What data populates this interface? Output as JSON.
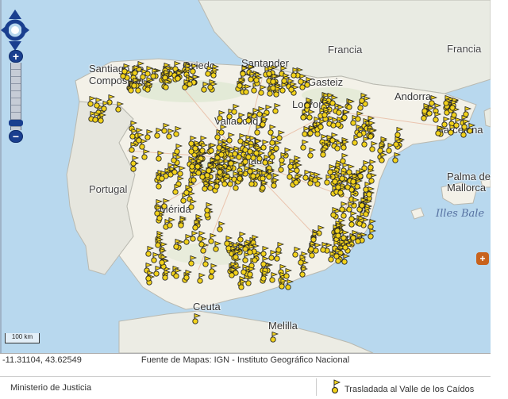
{
  "map": {
    "labels": {
      "francia1": "Francia",
      "francia2": "Francia",
      "portugal": "Portugal",
      "illes_balears": "Illes Bale",
      "palma": "Palma de\nMallorca",
      "santiago": "Santiago de\nCompostela",
      "oviedo": "Oviedo",
      "santander": "Santander",
      "gasteiz": "Gasteiz",
      "logrono": "Logroño",
      "andorra": "Andorra",
      "barcelona": "Barcelona",
      "valladolid": "Valladolid",
      "madrid": "Madrid",
      "merida": "Mérida",
      "murcia": "Murcia",
      "ceuta": "Ceuta",
      "melilla": "Melilla"
    },
    "scale_label": "100 km",
    "marker_color": "#f2d21b"
  },
  "status": {
    "coords": "-11.31104, 43.62549",
    "source": "Fuente de Mapas: IGN - Instituto Geográfico Nacional"
  },
  "footer": {
    "ministry": "Ministerio de Justicia",
    "legend_label": "Trasladada al Valle de los Caídos"
  },
  "controls": {
    "zoom_in": "+",
    "zoom_out": "−"
  }
}
